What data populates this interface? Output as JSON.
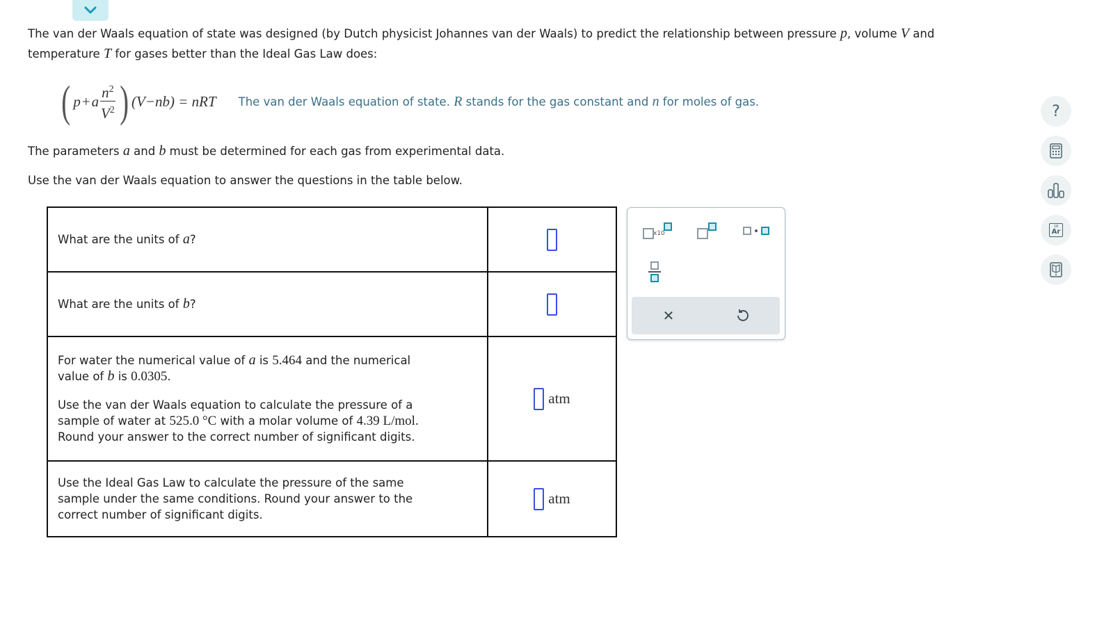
{
  "header": {
    "collapse_icon": "chevron-down-icon"
  },
  "intro": {
    "part1": "The van der Waals equation of state was designed (by Dutch physicist Johannes van der Waals) to predict the relationship between pressure ",
    "var_p": "p",
    "part2": ", volume ",
    "var_V": "V",
    "part3": " and",
    "part4": "temperature ",
    "var_T": "T",
    "part5": " for gases better than the Ideal Gas Law does:"
  },
  "equation": {
    "p": "p",
    "plus": "+",
    "a": "a",
    "num": "n",
    "num_exp": "2",
    "den": "V",
    "den_exp": "2",
    "rhs": "(V−nb) = nRT",
    "caption_1": "The van der Waals equation of state. ",
    "caption_R": "R",
    "caption_2": " stands for the gas constant and ",
    "caption_n": "n",
    "caption_3": " for moles of gas."
  },
  "params": {
    "part1": "The parameters ",
    "a": "a",
    "and": " and ",
    "b": "b",
    "part2": " must be determined for each gas from experimental data."
  },
  "use_line": "Use the van der Waals equation to answer the questions in the table below.",
  "table": {
    "rows": [
      {
        "q_pre": "What are the units of ",
        "q_var": "a",
        "q_post": "?",
        "answer": "",
        "unit": ""
      },
      {
        "q_pre": "What are the units of ",
        "q_var": "b",
        "q_post": "?",
        "answer": "",
        "unit": ""
      },
      {
        "line1_pre": "For water the numerical value of ",
        "line1_a": "a",
        "line1_mid": " is ",
        "a_value": "5.464",
        "line1_post": " and the numerical",
        "line2_pre": "value of ",
        "line2_b": "b",
        "line2_mid": " is ",
        "b_value": "0.0305",
        "line2_post": ".",
        "line3": "Use the van der Waals equation to calculate the pressure of a",
        "line4_pre": "sample of water at ",
        "temp": "525.0 °C",
        "line4_mid": " with a molar volume of ",
        "vol": "4.39  L/mol.",
        "line5": "Round your answer to the correct number of significant digits.",
        "answer": "",
        "unit": "atm"
      },
      {
        "line1": "Use the Ideal Gas Law to calculate the pressure of the same",
        "line2": "sample under the same conditions. Round your answer to the",
        "line3": "correct number of significant digits.",
        "answer": "",
        "unit": "atm"
      }
    ]
  },
  "palette": {
    "buttons": [
      "x10-notation",
      "superscript",
      "multiplication-dot",
      "fraction"
    ],
    "x10_label": "x10",
    "clear_icon": "✕",
    "undo_icon": "↺"
  },
  "side_tools": [
    {
      "name": "help",
      "glyph": "?"
    },
    {
      "name": "calculator"
    },
    {
      "name": "data-chart"
    },
    {
      "name": "periodic-table",
      "label": "Ar",
      "number": "18"
    },
    {
      "name": "reference-book"
    }
  ]
}
